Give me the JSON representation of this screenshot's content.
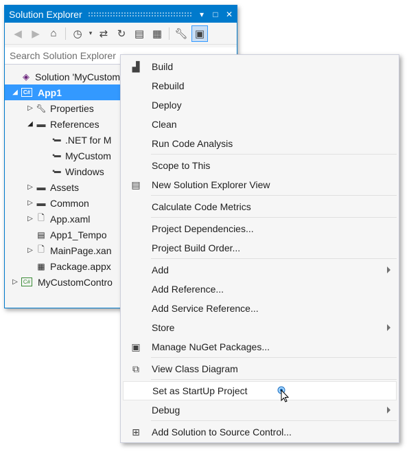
{
  "solution_explorer": {
    "title": "Solution Explorer",
    "title_buttons": [
      "▾",
      "□",
      "✕"
    ],
    "toolbar": [
      "back-icon",
      "forward-icon",
      "home-icon",
      "history-icon",
      "sync-icon",
      "refresh-icon",
      "collapse-all-icon",
      "show-all-files-icon",
      "properties-icon",
      "preview-icon"
    ],
    "search_placeholder": "Search Solution Explorer",
    "tree": [
      {
        "label": "Solution 'MyCustom",
        "icon": "solution-icon",
        "indent": 0,
        "arrow": ""
      },
      {
        "label": "App1",
        "icon": "project-icon",
        "indent": 0,
        "arrow": "◢",
        "selected": true
      },
      {
        "label": "Properties",
        "icon": "wrench-icon",
        "indent": 1,
        "arrow": "▷"
      },
      {
        "label": "References",
        "icon": "references-icon",
        "indent": 1,
        "arrow": "◢"
      },
      {
        "label": ".NET for M",
        "icon": "reference-icon",
        "indent": 2,
        "arrow": ""
      },
      {
        "label": "MyCustom",
        "icon": "reference-icon",
        "indent": 2,
        "arrow": ""
      },
      {
        "label": "Windows",
        "icon": "reference-icon",
        "indent": 2,
        "arrow": ""
      },
      {
        "label": "Assets",
        "icon": "folder-icon",
        "indent": 1,
        "arrow": "▷"
      },
      {
        "label": "Common",
        "icon": "folder-icon",
        "indent": 1,
        "arrow": "▷"
      },
      {
        "label": "App.xaml",
        "icon": "xaml-icon",
        "indent": 1,
        "arrow": "▷"
      },
      {
        "label": "App1_Tempo",
        "icon": "certificate-icon",
        "indent": 1,
        "arrow": ""
      },
      {
        "label": "MainPage.xan",
        "icon": "xaml-icon",
        "indent": 1,
        "arrow": "▷"
      },
      {
        "label": "Package.appx",
        "icon": "manifest-icon",
        "indent": 1,
        "arrow": ""
      },
      {
        "label": "MyCustomContro",
        "icon": "project-icon",
        "indent": 0,
        "arrow": "▷"
      }
    ]
  },
  "context_menu": {
    "items": [
      {
        "label": "Build",
        "icon": "build-icon"
      },
      {
        "label": "Rebuild"
      },
      {
        "label": "Deploy"
      },
      {
        "label": "Clean"
      },
      {
        "label": "Run Code Analysis"
      },
      {
        "separator": true
      },
      {
        "label": "Scope to This"
      },
      {
        "label": "New Solution Explorer View",
        "icon": "new-view-icon"
      },
      {
        "separator": true
      },
      {
        "label": "Calculate Code Metrics"
      },
      {
        "separator": true
      },
      {
        "label": "Project Dependencies..."
      },
      {
        "label": "Project Build Order..."
      },
      {
        "separator": true
      },
      {
        "label": "Add",
        "submenu": true
      },
      {
        "label": "Add Reference..."
      },
      {
        "label": "Add Service Reference..."
      },
      {
        "label": "Store",
        "submenu": true
      },
      {
        "label": "Manage NuGet Packages...",
        "icon": "nuget-icon"
      },
      {
        "separator": true
      },
      {
        "label": "View Class Diagram",
        "icon": "class-diagram-icon"
      },
      {
        "separator": true
      },
      {
        "label": "Set as StartUp Project",
        "hover": true
      },
      {
        "label": "Debug",
        "submenu": true
      },
      {
        "separator": true
      },
      {
        "label": "Add Solution to Source Control...",
        "icon": "source-control-icon"
      }
    ]
  },
  "colors": {
    "accent": "#007acc",
    "selection": "#3399ff",
    "menu_bg": "#f6f6f6"
  }
}
